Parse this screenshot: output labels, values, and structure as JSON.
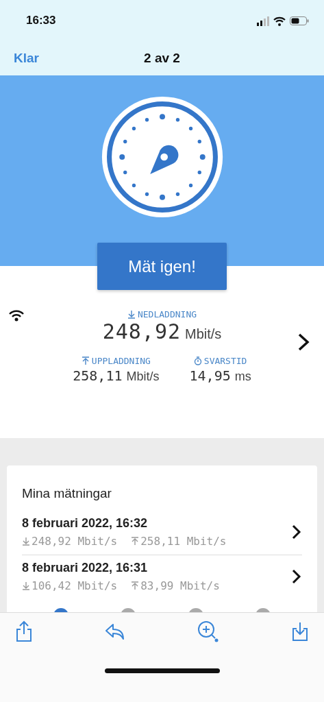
{
  "status_bar": {
    "time": "16:33"
  },
  "nav": {
    "done": "Klar",
    "title": "2 av 2"
  },
  "hero": {
    "button": "Mät igen!"
  },
  "result": {
    "download": {
      "label": "NEDLADDNING",
      "value": "248,92",
      "unit": "Mbit/s"
    },
    "upload": {
      "label": "UPPLADDNING",
      "value": "258,11",
      "unit": "Mbit/s"
    },
    "ping": {
      "label": "SVARSTID",
      "value": "14,95",
      "unit": "ms"
    }
  },
  "history": {
    "title": "Mina mätningar",
    "items": [
      {
        "date": "8 februari 2022, 16:32",
        "download": "248,92 Mbit/s",
        "upload": "258,11 Mbit/s"
      },
      {
        "date": "8 februari 2022, 16:31",
        "download": "106,42 Mbit/s",
        "upload": "83,99 Mbit/s"
      }
    ]
  },
  "tab_bar": {
    "tabs": [
      {
        "selected": true
      },
      {
        "selected": false
      },
      {
        "selected": false
      },
      {
        "selected": false
      }
    ]
  }
}
